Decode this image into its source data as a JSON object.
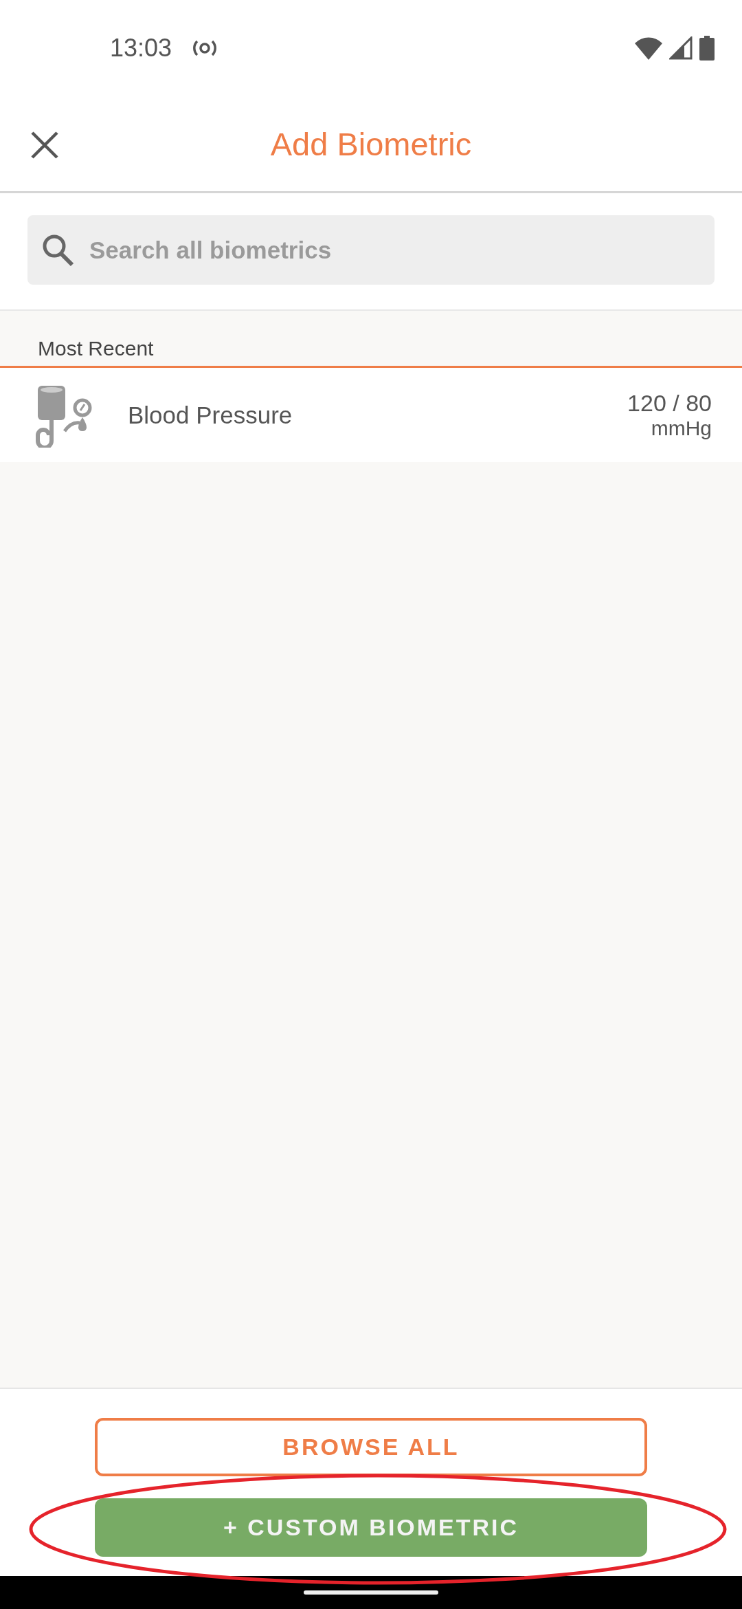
{
  "status_bar": {
    "time": "13:03"
  },
  "header": {
    "title": "Add Biometric"
  },
  "search": {
    "placeholder": "Search all biometrics"
  },
  "sections": [
    {
      "title": "Most Recent",
      "items": [
        {
          "name": "Blood Pressure",
          "value": "120 / 80",
          "unit": "mmHg"
        }
      ]
    }
  ],
  "buttons": [
    {
      "kind": "outline",
      "label": "BROWSE ALL",
      "highlighted": false
    },
    {
      "kind": "filled",
      "label": "+ CUSTOM BIOMETRIC",
      "highlighted": true
    }
  ]
}
